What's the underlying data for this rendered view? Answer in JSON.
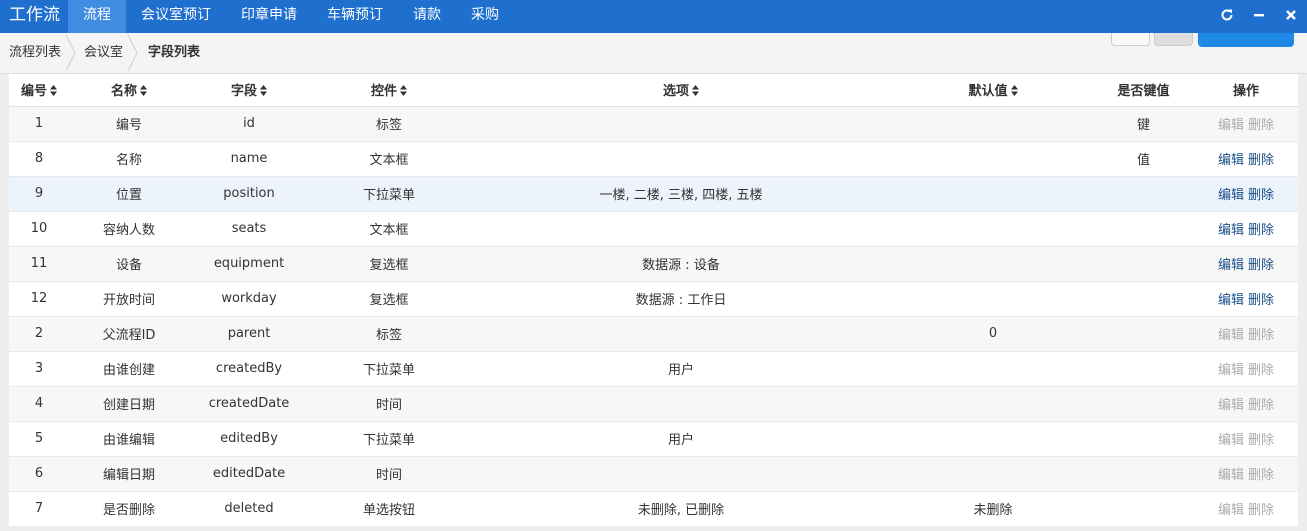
{
  "nav": {
    "brand": "工作流",
    "items": [
      {
        "label": "流程",
        "active": true
      },
      {
        "label": "会议室预订",
        "active": false
      },
      {
        "label": "印章申请",
        "active": false
      },
      {
        "label": "车辆预订",
        "active": false
      },
      {
        "label": "请款",
        "active": false
      },
      {
        "label": "采购",
        "active": false
      }
    ],
    "controls": [
      "refresh-icon",
      "minimize-icon",
      "close-icon"
    ]
  },
  "breadcrumb": [
    "流程列表",
    "会议室",
    "字段列表"
  ],
  "table": {
    "headers": [
      {
        "label": "编号",
        "sortable": true
      },
      {
        "label": "名称",
        "sortable": true
      },
      {
        "label": "字段",
        "sortable": true
      },
      {
        "label": "控件",
        "sortable": true
      },
      {
        "label": "选项",
        "sortable": true
      },
      {
        "label": "默认值",
        "sortable": true
      },
      {
        "label": "是否键值",
        "sortable": false
      },
      {
        "label": "操作",
        "sortable": false
      }
    ],
    "rows": [
      {
        "id": "1",
        "name": "编号",
        "field": "id",
        "control": "标签",
        "options": "",
        "default": "",
        "key": "键",
        "editable": false
      },
      {
        "id": "8",
        "name": "名称",
        "field": "name",
        "control": "文本框",
        "options": "",
        "default": "",
        "key": "值",
        "editable": true
      },
      {
        "id": "9",
        "name": "位置",
        "field": "position",
        "control": "下拉菜单",
        "options": "一楼, 二楼, 三楼, 四楼, 五楼",
        "default": "",
        "key": "",
        "editable": true
      },
      {
        "id": "10",
        "name": "容纳人数",
        "field": "seats",
        "control": "文本框",
        "options": "",
        "default": "",
        "key": "",
        "editable": true
      },
      {
        "id": "11",
        "name": "设备",
        "field": "equipment",
        "control": "复选框",
        "options": "数据源 : 设备",
        "default": "",
        "key": "",
        "editable": true
      },
      {
        "id": "12",
        "name": "开放时间",
        "field": "workday",
        "control": "复选框",
        "options": "数据源 : 工作日",
        "default": "",
        "key": "",
        "editable": true
      },
      {
        "id": "2",
        "name": "父流程ID",
        "field": "parent",
        "control": "标签",
        "options": "",
        "default": "0",
        "key": "",
        "editable": false
      },
      {
        "id": "3",
        "name": "由谁创建",
        "field": "createdBy",
        "control": "下拉菜单",
        "options": "用户",
        "default": "",
        "key": "",
        "editable": false
      },
      {
        "id": "4",
        "name": "创建日期",
        "field": "createdDate",
        "control": "时间",
        "options": "",
        "default": "",
        "key": "",
        "editable": false
      },
      {
        "id": "5",
        "name": "由谁编辑",
        "field": "editedBy",
        "control": "下拉菜单",
        "options": "用户",
        "default": "",
        "key": "",
        "editable": false
      },
      {
        "id": "6",
        "name": "编辑日期",
        "field": "editedDate",
        "control": "时间",
        "options": "",
        "default": "",
        "key": "",
        "editable": false
      },
      {
        "id": "7",
        "name": "是否删除",
        "field": "deleted",
        "control": "单选按钮",
        "options": "未删除, 已删除",
        "default": "未删除",
        "key": "",
        "editable": false
      }
    ],
    "actions": {
      "edit": "编辑",
      "delete": "删除"
    },
    "highlighted_row": 2
  },
  "colors": {
    "nav_bg": "#1f6fcf",
    "nav_active": "#3f8ce0",
    "primary_button": "#1e88e5",
    "action_link": "#1a4f8a",
    "action_disabled": "#aaaaaa",
    "row_highlight": "#ecf3fb"
  }
}
